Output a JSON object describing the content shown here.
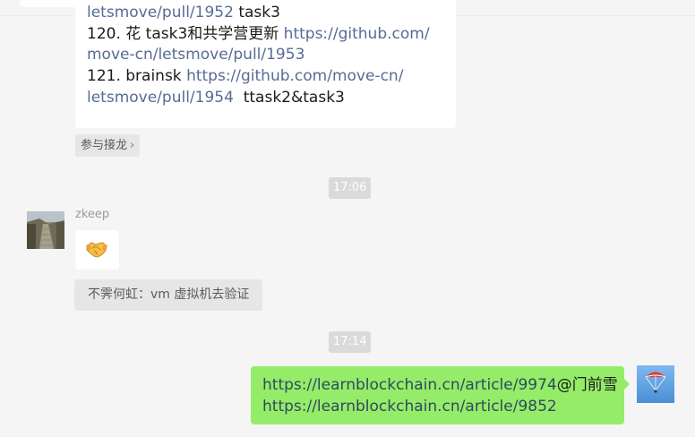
{
  "chat": {
    "link_message": {
      "line1_link": "letsmove/pull/1952",
      "line1_text": " task3",
      "line2_text": "120. 花 task3和共学营更新 ",
      "line2_link": "https://github.com/",
      "line3_link": "move-cn/letsmove/pull/1953",
      "line4_text": "121. brainsk ",
      "line4_link": "https://github.com/move-cn/",
      "line5_link": "letsmove/pull/1954",
      "line5_text": "  ttask2&task3"
    },
    "join_label": "参与接龙",
    "join_chevron": "›",
    "time_1": "17:06",
    "time_2": "17:14",
    "sender_name": "zkeep",
    "emoji_icon": "handshake-icon",
    "quote_text": "不霁何虹：vm 虚拟机去验证",
    "self_message": {
      "line1_url": "https://learnblockchain.cn/article/9974",
      "line1_mention": "@门前雪",
      "line2_url": "https://learnblockchain.cn/article/9852"
    }
  },
  "colors": {
    "link": "#576b95",
    "self_bubble": "#95ec69",
    "background": "#f5f5f5",
    "time_badge": "#dadada"
  }
}
